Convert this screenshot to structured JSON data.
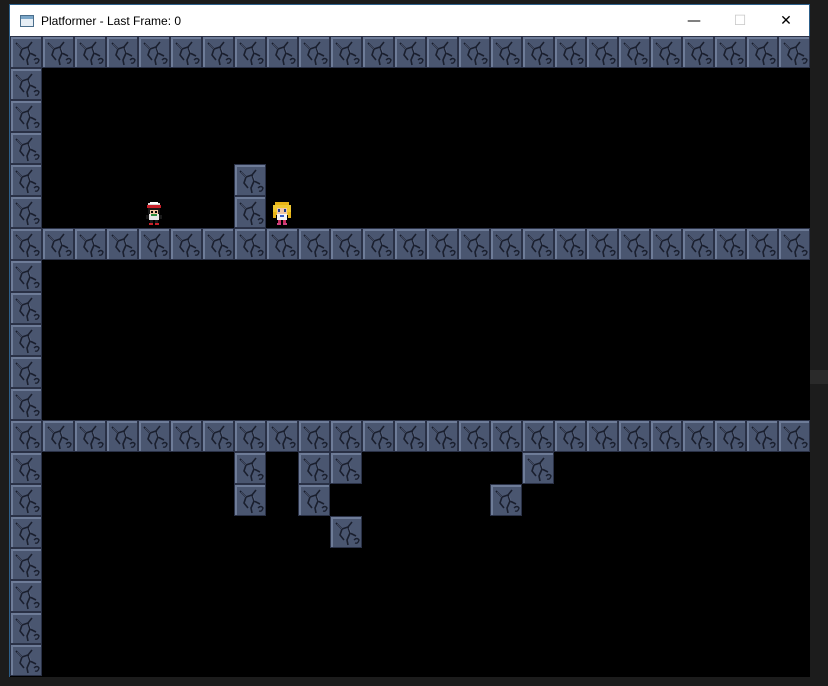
{
  "window": {
    "title": "Platformer - Last Frame: 0",
    "minimize_glyph": "—",
    "maximize_glyph": "☐",
    "close_glyph": "✕",
    "app_icon": "window-app-icon"
  },
  "colors": {
    "frame_border": "#2c5f8a",
    "titlebar": "#ffffff",
    "game_background": "#000000",
    "tile_base": "#4a5670",
    "tile_highlight": "#6e7c98",
    "tile_shadow": "#2a3146",
    "tile_crack": "#1a1f2e"
  },
  "level": {
    "tile_size": 32,
    "rows": [
      "#########################",
      "#                        ",
      "#                        ",
      "#                        ",
      "#      #                 ",
      "#      #                 ",
      "#########################",
      "#                        ",
      "#                        ",
      "#                        ",
      "#                        ",
      "#                        ",
      "#########################",
      "#      # ##     #        ",
      "#      # #     #         ",
      "#         #              ",
      "#                        ",
      "#                        ",
      "#                        ",
      "#                        "
    ]
  },
  "characters": [
    {
      "name": "quote",
      "col": 4,
      "row": 5
    },
    {
      "name": "curly",
      "col": 8,
      "row": 5
    }
  ]
}
